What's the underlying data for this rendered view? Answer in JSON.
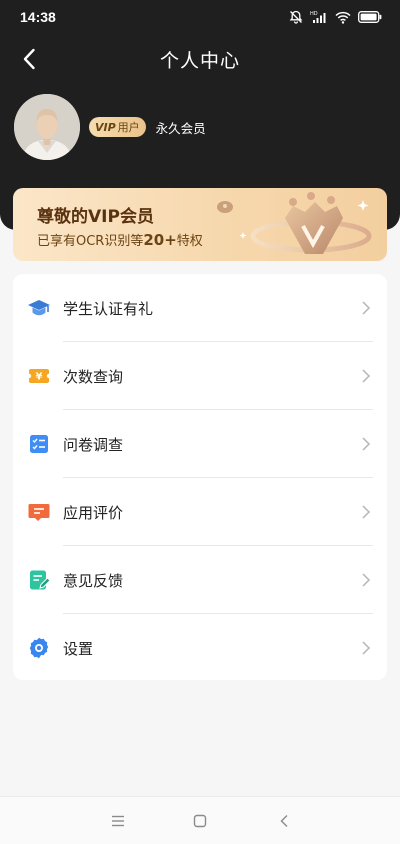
{
  "status_bar": {
    "time": "14:38",
    "icons": [
      "mute-bell-icon",
      "hd-signal-icon",
      "wifi-icon",
      "battery-icon"
    ]
  },
  "nav": {
    "title": "个人中心",
    "back_icon": "back-arrow-icon"
  },
  "profile": {
    "avatar_icon": "user-avatar",
    "vip_badge_prefix": "VIP",
    "vip_badge_label": "用户",
    "member_type": "永久会员"
  },
  "vip_card": {
    "title": "尊敬的VIP会员",
    "subtitle_prefix": "已享有OCR识别等",
    "subtitle_count": "20+",
    "subtitle_suffix": "特权",
    "art_icon": "vip-crown-icon"
  },
  "menu": {
    "items": [
      {
        "label": "学生认证有礼",
        "icon": "graduation-cap-icon"
      },
      {
        "label": "次数查询",
        "icon": "yen-ticket-icon"
      },
      {
        "label": "问卷调查",
        "icon": "checklist-icon"
      },
      {
        "label": "应用评价",
        "icon": "comment-icon"
      },
      {
        "label": "意见反馈",
        "icon": "feedback-edit-icon"
      },
      {
        "label": "设置",
        "icon": "gear-icon"
      }
    ]
  },
  "colors": {
    "header_bg": "#1f1f1f",
    "page_bg": "#f6f6f6",
    "vip_gold": "#f6d7ac",
    "vip_text": "#5a3210",
    "cap_blue": "#3a7bd5",
    "ticket_orange": "#f5a623",
    "checklist_blue": "#3f8df5",
    "comment_orange": "#f06a3c",
    "feedback_green": "#2ec4a0",
    "gear_blue": "#3a86f0"
  },
  "system_nav": {
    "icons": [
      "menu-lines-icon",
      "home-square-icon",
      "back-chevron-icon"
    ]
  }
}
